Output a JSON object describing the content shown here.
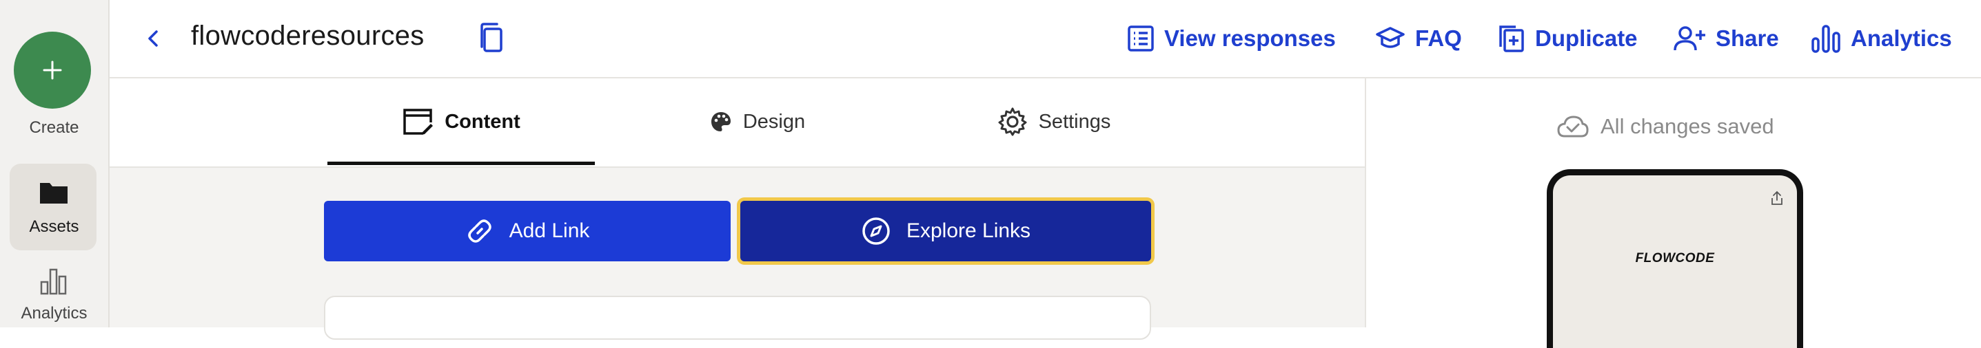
{
  "sidebar": {
    "create_label": "Create",
    "items": [
      {
        "label": "Assets",
        "icon": "folder-icon",
        "active": true
      },
      {
        "label": "Analytics",
        "icon": "bar-chart-icon",
        "active": false
      }
    ]
  },
  "header": {
    "title": "flowcoderesources",
    "actions": [
      {
        "label": "View responses",
        "icon": "list-icon"
      },
      {
        "label": "FAQ",
        "icon": "graduation-cap-icon"
      },
      {
        "label": "Duplicate",
        "icon": "duplicate-icon"
      },
      {
        "label": "Share",
        "icon": "add-user-icon"
      },
      {
        "label": "Analytics",
        "icon": "analytics-icon"
      }
    ]
  },
  "tabs": [
    {
      "label": "Content",
      "icon": "content-edit-icon",
      "active": true
    },
    {
      "label": "Design",
      "icon": "palette-icon",
      "active": false
    },
    {
      "label": "Settings",
      "icon": "gear-icon",
      "active": false
    }
  ],
  "buttons": {
    "add_link": "Add Link",
    "explore_links": "Explore Links"
  },
  "preview": {
    "status": "All changes saved",
    "brand": "FLOWCODE"
  },
  "colors": {
    "accent": "#1f3fcf",
    "primary_button": "#1c3bd6",
    "dark_button": "#16279a",
    "focus_ring": "#f1c84a",
    "create_green": "#3d8a4f"
  }
}
